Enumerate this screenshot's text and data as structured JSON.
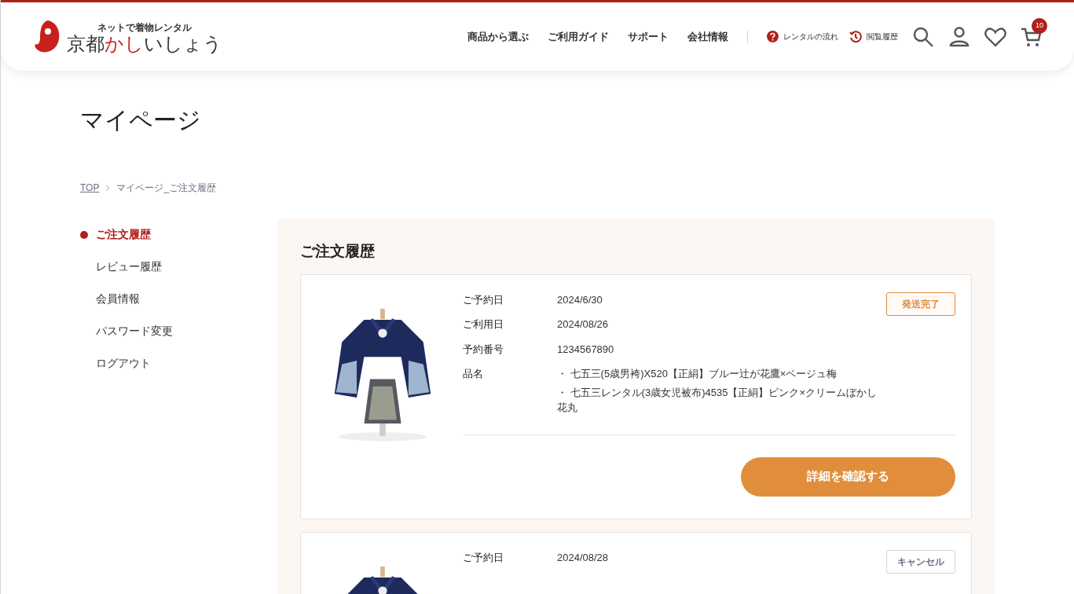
{
  "header": {
    "tagline": "ネットで着物レンタル",
    "logo_text_1": "京都",
    "logo_text_2": "かし",
    "logo_text_3": "いしょう",
    "nav": [
      "商品から選ぶ",
      "ご利用ガイド",
      "サポート",
      "会社情報"
    ],
    "links": [
      {
        "kind": "flow",
        "label": "レンタルの流れ"
      },
      {
        "kind": "history",
        "label": "閲覧履歴"
      }
    ],
    "cart_count": "10"
  },
  "page_title": "マイページ",
  "breadcrumb": [
    {
      "label": "TOP",
      "link": true
    },
    {
      "label": "マイページ_ご注文履歴",
      "link": false
    }
  ],
  "sidebar": [
    {
      "label": "ご注文履歴",
      "selected": true
    },
    {
      "label": "レビュー履歴",
      "selected": false
    },
    {
      "label": "会員情報",
      "selected": false
    },
    {
      "label": "パスワード変更",
      "selected": false
    },
    {
      "label": "ログアウト",
      "selected": false
    }
  ],
  "section_title": "ご注文履歴",
  "orders": [
    {
      "picture": {
        "kind": "picture"
      },
      "status": {
        "label": "発送完了",
        "kind": "shipped"
      },
      "fields": [
        {
          "label": "ご予約日",
          "values": [
            "2024/6/30"
          ]
        },
        {
          "label": "ご利用日",
          "values": [
            "2024/08/26"
          ]
        },
        {
          "label": "予約番号",
          "values": [
            "1234567890"
          ]
        },
        {
          "label": "品名",
          "values": [
            "・ 七五三(5歳男袴)X520【正絹】ブルー辻が花鷹×ベージュ梅",
            "・ 七五三レンタル(3歳女児被布)4535【正絹】ピンク×クリームぼかし花丸"
          ]
        }
      ],
      "button": "詳細を確認する"
    },
    {
      "picture": {
        "kind": "picture"
      },
      "status": {
        "label": "キャンセル",
        "kind": "cancel"
      },
      "fields": [
        {
          "label": "ご予約日",
          "values": [
            "2024/08/28"
          ]
        }
      ]
    }
  ]
}
